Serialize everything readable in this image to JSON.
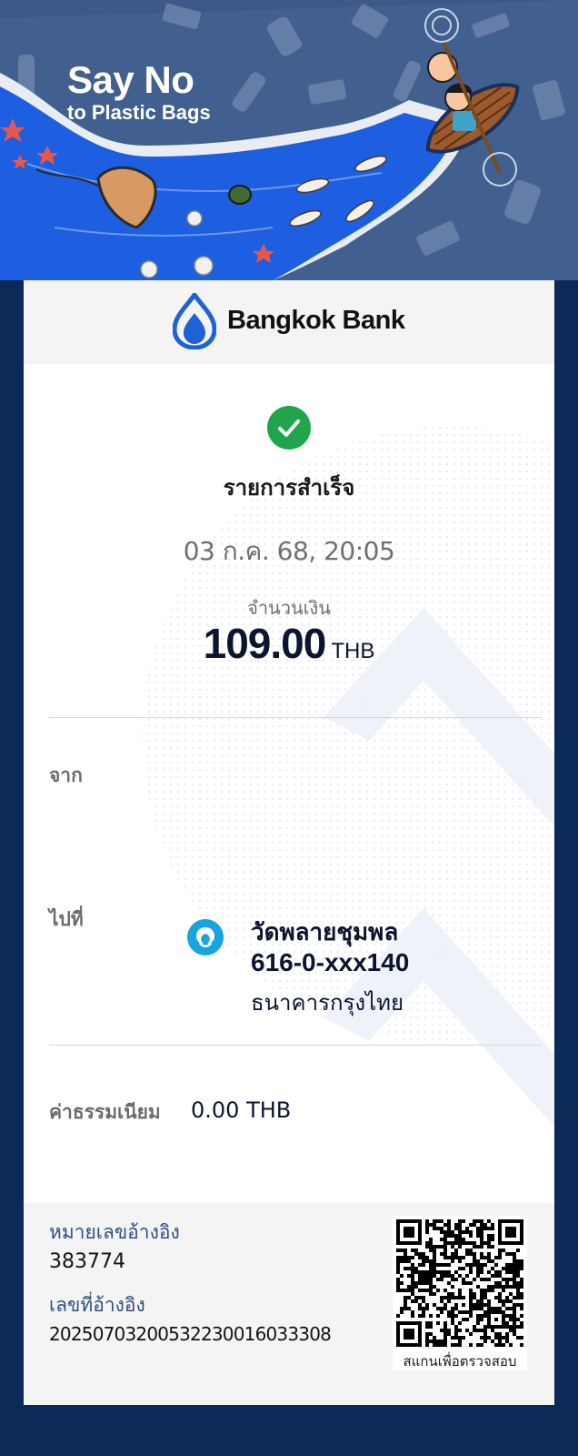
{
  "banner": {
    "title": "Say No",
    "subtitle": "to Plastic Bags"
  },
  "brand": {
    "name": "Bangkok Bank",
    "color": "#1e63d6"
  },
  "receipt": {
    "status": "รายการสำเร็จ",
    "datetime": "03 ก.ค. 68, 20:05",
    "amount_label": "จำนวนเงิน",
    "amount": "109.00",
    "currency": "THB",
    "from_label": "จาก",
    "to_label": "ไปที่",
    "to": {
      "name": "วัดพลายชุมพล",
      "account": "616-0-xxx140",
      "bank": "ธนาคารกรุงไทย",
      "bank_icon": "krungthai-bank-icon",
      "bank_color": "#16a5df"
    },
    "fee_label": "ค่าธรรมเนียม",
    "fee_value": "0.00 THB"
  },
  "footer": {
    "ref1_label": "หมายเลขอ้างอิง",
    "ref1_value": "383774",
    "ref2_label": "เลขที่อ้างอิง",
    "ref2_value": "20250703200532230016033308",
    "qr_caption": "สแกนเพื่อตรวจสอบ"
  },
  "colors": {
    "page_background": "#0b2a57",
    "success_green": "#1fa64a",
    "reference_label": "#2f4f82"
  }
}
